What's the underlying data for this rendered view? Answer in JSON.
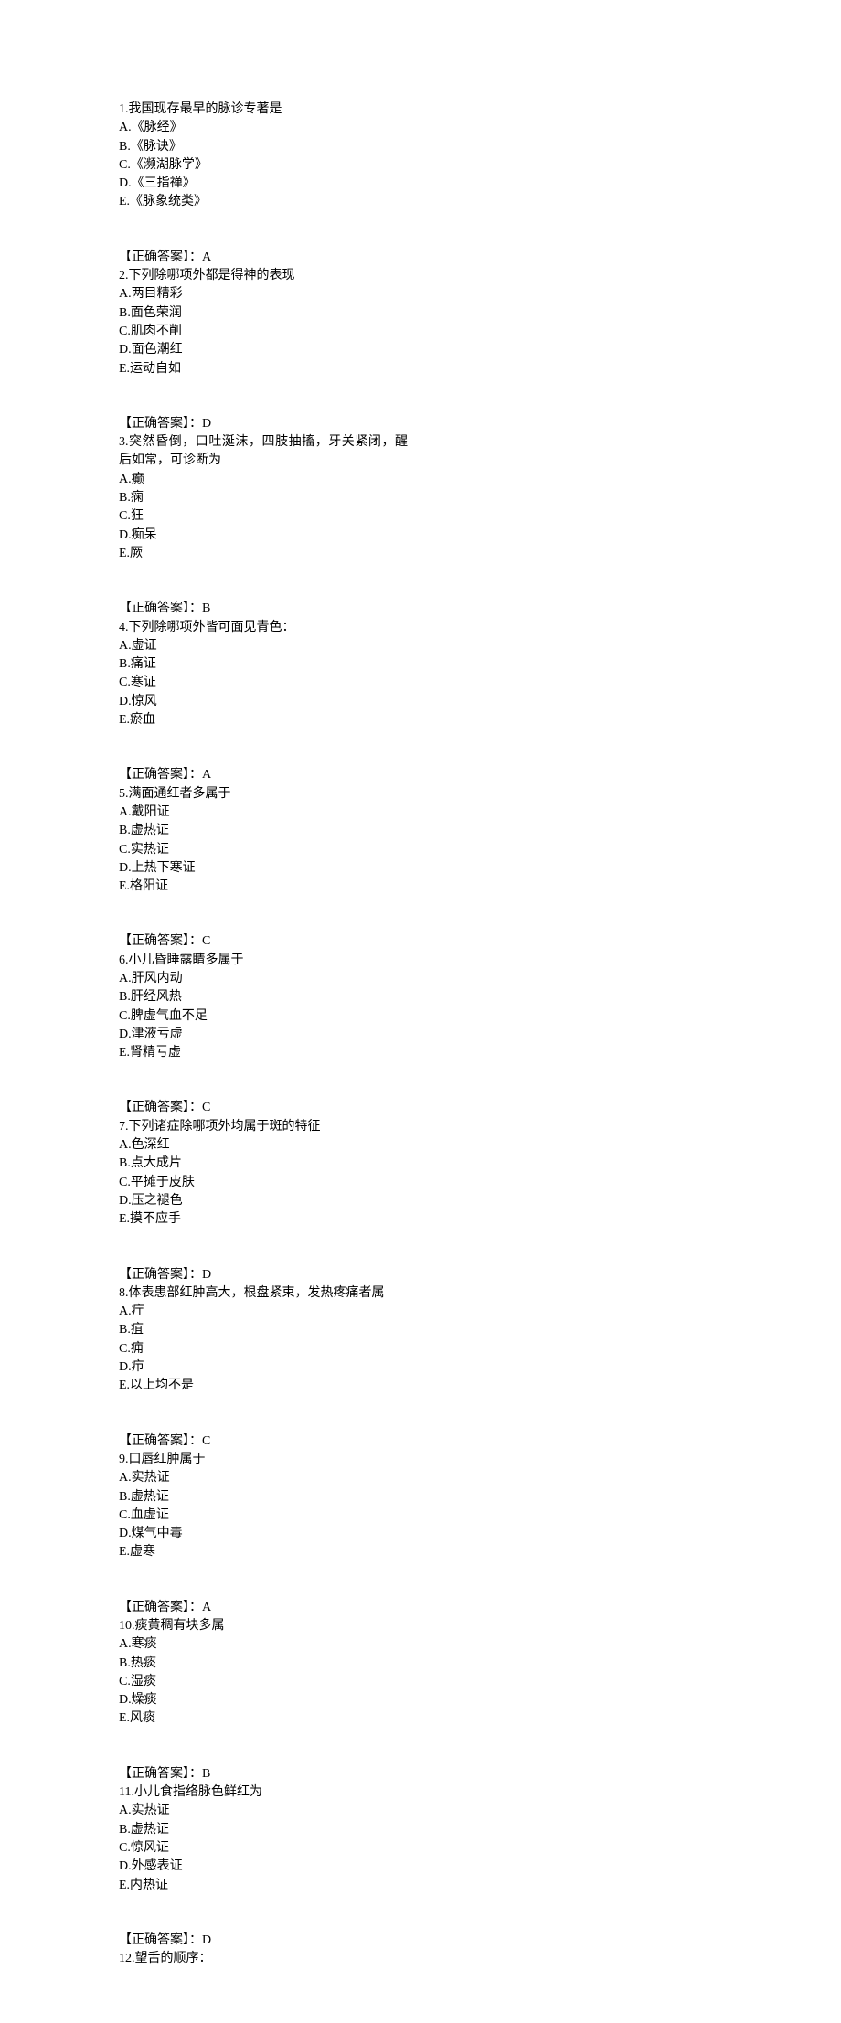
{
  "questions": [
    {
      "num": "1",
      "text": "我国现存最早的脉诊专著是",
      "options": [
        {
          "label": "A",
          "text": "《脉经》"
        },
        {
          "label": "B",
          "text": "《脉诀》"
        },
        {
          "label": "C",
          "text": "《濒湖脉学》"
        },
        {
          "label": "D",
          "text": "《三指禅》"
        },
        {
          "label": "E",
          "text": "《脉象统类》"
        }
      ],
      "answer": "A"
    },
    {
      "num": "2",
      "text": "下列除哪项外都是得神的表现",
      "options": [
        {
          "label": "A",
          "text": "两目精彩"
        },
        {
          "label": "B",
          "text": "面色荣润"
        },
        {
          "label": "C",
          "text": "肌肉不削"
        },
        {
          "label": "D",
          "text": "面色潮红"
        },
        {
          "label": "E",
          "text": "运动自如"
        }
      ],
      "answer": "D"
    },
    {
      "num": "3",
      "text": "突然昏倒，口吐涎沫，四肢抽搐，牙关紧闭，醒后如常，可诊断为",
      "options": [
        {
          "label": "A",
          "text": "癫"
        },
        {
          "label": "B",
          "text": "痫"
        },
        {
          "label": "C",
          "text": "狂"
        },
        {
          "label": "D",
          "text": "痴呆"
        },
        {
          "label": "E",
          "text": "厥"
        }
      ],
      "answer": "B"
    },
    {
      "num": "4",
      "text": "下列除哪项外皆可面见青色：",
      "options": [
        {
          "label": "A",
          "text": "虚证"
        },
        {
          "label": "B",
          "text": "痛证"
        },
        {
          "label": "C",
          "text": "寒证"
        },
        {
          "label": "D",
          "text": "惊风"
        },
        {
          "label": "E",
          "text": "瘀血"
        }
      ],
      "answer": "A"
    },
    {
      "num": "5",
      "text": "满面通红者多属于",
      "options": [
        {
          "label": "A",
          "text": "戴阳证"
        },
        {
          "label": "B",
          "text": "虚热证"
        },
        {
          "label": "C",
          "text": "实热证"
        },
        {
          "label": "D",
          "text": "上热下寒证"
        },
        {
          "label": "E",
          "text": "格阳证"
        }
      ],
      "answer": "C"
    },
    {
      "num": "6",
      "text": "小儿昏睡露睛多属于",
      "options": [
        {
          "label": "A",
          "text": "肝风内动"
        },
        {
          "label": "B",
          "text": "肝经风热"
        },
        {
          "label": "C",
          "text": "脾虚气血不足"
        },
        {
          "label": "D",
          "text": "津液亏虚"
        },
        {
          "label": "E",
          "text": "肾精亏虚"
        }
      ],
      "answer": "C"
    },
    {
      "num": "7",
      "text": "下列诸症除哪项外均属于斑的特征",
      "options": [
        {
          "label": "A",
          "text": "色深红"
        },
        {
          "label": "B",
          "text": "点大成片"
        },
        {
          "label": "C",
          "text": "平摊于皮肤"
        },
        {
          "label": "D",
          "text": "压之褪色"
        },
        {
          "label": "E",
          "text": "摸不应手"
        }
      ],
      "answer": "D"
    },
    {
      "num": "8",
      "text": "体表患部红肿高大，根盘紧束，发热疼痛者属",
      "options": [
        {
          "label": "A",
          "text": "疔"
        },
        {
          "label": "B",
          "text": "疽"
        },
        {
          "label": "C",
          "text": "痈"
        },
        {
          "label": "D",
          "text": "疖"
        },
        {
          "label": "E",
          "text": "以上均不是"
        }
      ],
      "answer": "C"
    },
    {
      "num": "9",
      "text": "口唇红肿属于",
      "options": [
        {
          "label": "A",
          "text": "实热证"
        },
        {
          "label": "B",
          "text": "虚热证"
        },
        {
          "label": "C",
          "text": "血虚证"
        },
        {
          "label": "D",
          "text": "煤气中毒"
        },
        {
          "label": "E",
          "text": "虚寒"
        }
      ],
      "answer": "A"
    },
    {
      "num": "10",
      "text": "痰黄稠有块多属",
      "options": [
        {
          "label": "A",
          "text": "寒痰"
        },
        {
          "label": "B",
          "text": "热痰"
        },
        {
          "label": "C",
          "text": "湿痰"
        },
        {
          "label": "D",
          "text": "燥痰"
        },
        {
          "label": "E",
          "text": "风痰"
        }
      ],
      "answer": "B"
    },
    {
      "num": "11",
      "text": "小儿食指络脉色鲜红为",
      "options": [
        {
          "label": "A",
          "text": "实热证"
        },
        {
          "label": "B",
          "text": "虚热证"
        },
        {
          "label": "C",
          "text": "惊风证"
        },
        {
          "label": "D",
          "text": "外感表证"
        },
        {
          "label": "E",
          "text": "内热证"
        }
      ],
      "answer": "D"
    },
    {
      "num": "12",
      "text": "望舌的顺序：",
      "options": [],
      "answer": null
    }
  ],
  "labels": {
    "answerPrefix": "【正确答案】："
  }
}
